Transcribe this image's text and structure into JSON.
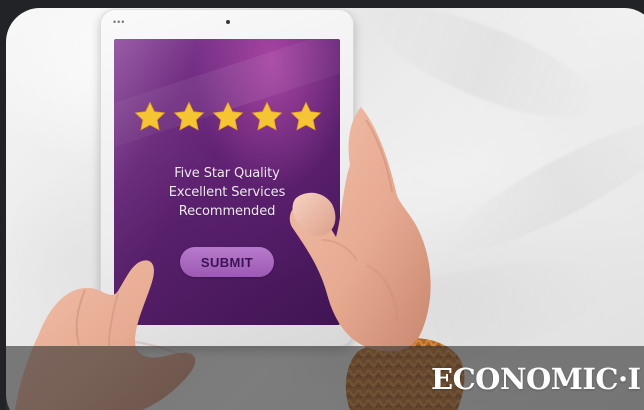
{
  "photo": {
    "device": "tablet",
    "rating_icons": [
      "star-icon",
      "star-icon",
      "star-icon",
      "star-icon",
      "star-icon"
    ],
    "rating_value": 5,
    "rating_max": 5,
    "screen_lines": [
      "Five Star Quality",
      "Excellent Services",
      "Recommended"
    ],
    "button_label": "SUBMIT"
  },
  "watermark": {
    "visible_text": "ECONOMIC·I"
  },
  "colors": {
    "screen_purple": "#5a216d",
    "button_purple": "#a865bd",
    "star_gold": "#f6c532",
    "sleeve_orange": "#b76b26",
    "caption_overlay": "#333333"
  }
}
